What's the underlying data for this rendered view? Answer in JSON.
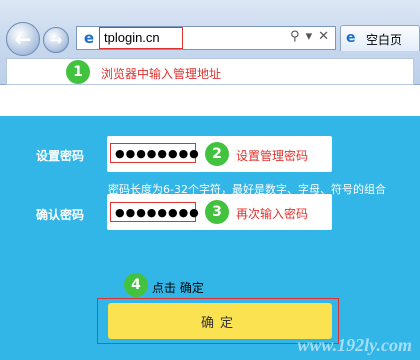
{
  "browser": {
    "url": "tplogin.cn",
    "tab_title": "空白页",
    "back_icon": "←",
    "forward_icon": "→",
    "address_controls": [
      "⚲",
      "▾",
      "✕"
    ]
  },
  "annotations": {
    "step1": {
      "number": "1",
      "text": "浏览器中输入管理地址"
    },
    "step2": {
      "number": "2",
      "text": "设置管理密码"
    },
    "step3": {
      "number": "3",
      "text": "再次输入密码"
    },
    "step4": {
      "number": "4",
      "text": "点击 确定"
    }
  },
  "form": {
    "password_label": "设置密码",
    "password_value": "●●●●●●●●",
    "password_hint": "密码长度为6-32个字符，最好是数字、字母、符号的组合",
    "confirm_label": "确认密码",
    "confirm_value": "●●●●●●●●",
    "confirm_button": "确定"
  },
  "watermark": "www.192ly.com",
  "colors": {
    "panel_bg": "#32b6e8",
    "button_bg": "#fbe251",
    "highlight_red": "#e0332f",
    "badge_green": "#42c23e"
  }
}
